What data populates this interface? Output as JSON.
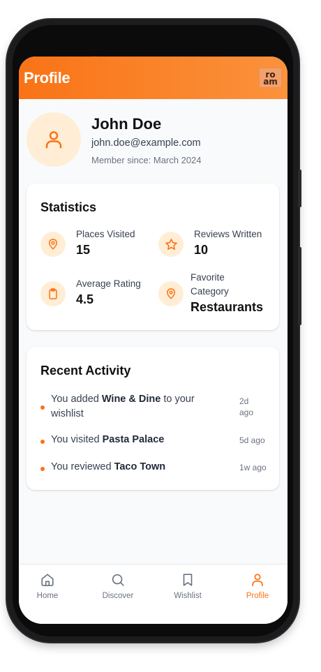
{
  "header": {
    "title": "Profile",
    "logo_line1": "ro",
    "logo_line2": "am"
  },
  "profile": {
    "name": "John Doe",
    "email": "john.doe@example.com",
    "member_since": "Member since: March 2024"
  },
  "statistics": {
    "title": "Statistics",
    "items": [
      {
        "icon": "map-pin-icon",
        "label": "Places Visited",
        "value": "15"
      },
      {
        "icon": "star-icon",
        "label": "Reviews Written",
        "value": "10"
      },
      {
        "icon": "clipboard-icon",
        "label": "Average Rating",
        "value": "4.5"
      },
      {
        "icon": "map-pin-icon",
        "label_line1": "Favorite",
        "label_line2": "Category",
        "value": "Restaurants"
      }
    ]
  },
  "activity": {
    "title": "Recent Activity",
    "items": [
      {
        "prefix": "You added ",
        "place": "Wine & Dine",
        "suffix_line1": " to your",
        "suffix_line2": "wishlist",
        "time_line1": "2d",
        "time_line2": "ago"
      },
      {
        "prefix": "You visited ",
        "place": "Pasta Palace",
        "time": "5d ago"
      },
      {
        "prefix": "You reviewed ",
        "place": "Taco Town",
        "time": "1w ago"
      }
    ]
  },
  "nav": {
    "items": [
      {
        "label": "Home",
        "icon": "home-icon"
      },
      {
        "label": "Discover",
        "icon": "search-icon"
      },
      {
        "label": "Wishlist",
        "icon": "bookmark-icon"
      },
      {
        "label": "Profile",
        "icon": "user-icon",
        "active": true
      }
    ]
  },
  "colors": {
    "accent": "#f97316",
    "accent_light": "#ffedd5",
    "screen_bg": "#f9fafb"
  }
}
